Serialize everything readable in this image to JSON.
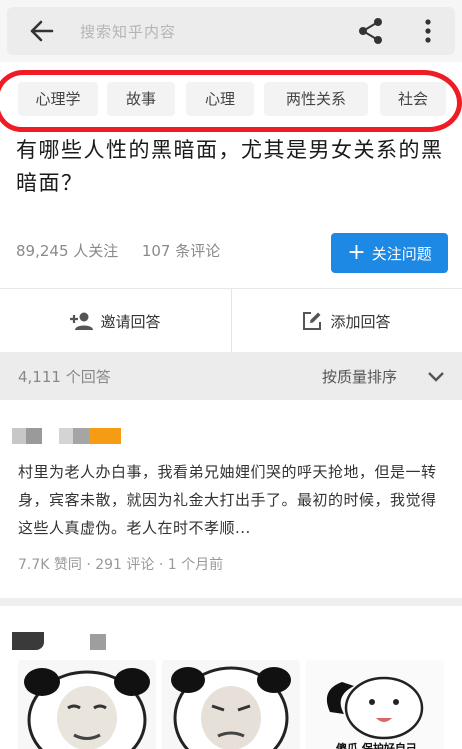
{
  "search": {
    "placeholder": "搜索知乎内容"
  },
  "tags": [
    "心理学",
    "故事",
    "心理",
    "两性关系",
    "社会"
  ],
  "question": {
    "title": "有哪些人性的黑暗面，尤其是男女关系的黑暗面？",
    "followers": "89,245 人关注",
    "comments": "107 条评论",
    "follow_label": "关注问题"
  },
  "actions": {
    "invite": "邀请回答",
    "add": "添加回答"
  },
  "answers": {
    "count": "4,111 个回答",
    "sort": "按质量排序"
  },
  "answer1": {
    "text": "村里为老人办白事，我看弟兄妯娌们哭的呼天抢地，但是一转身，宾客未散，就因为礼金大打出手了。最初的时候，我觉得这些人真虚伪。老人在时不孝顺...",
    "meta": "7.7K 赞同 · 291 评论 · 1 个月前"
  },
  "answer2": {
    "image3_caption": "傻瓜 保护好自己"
  },
  "colors": {
    "accent": "#1e88e5",
    "annotation": "#ee1c25"
  }
}
